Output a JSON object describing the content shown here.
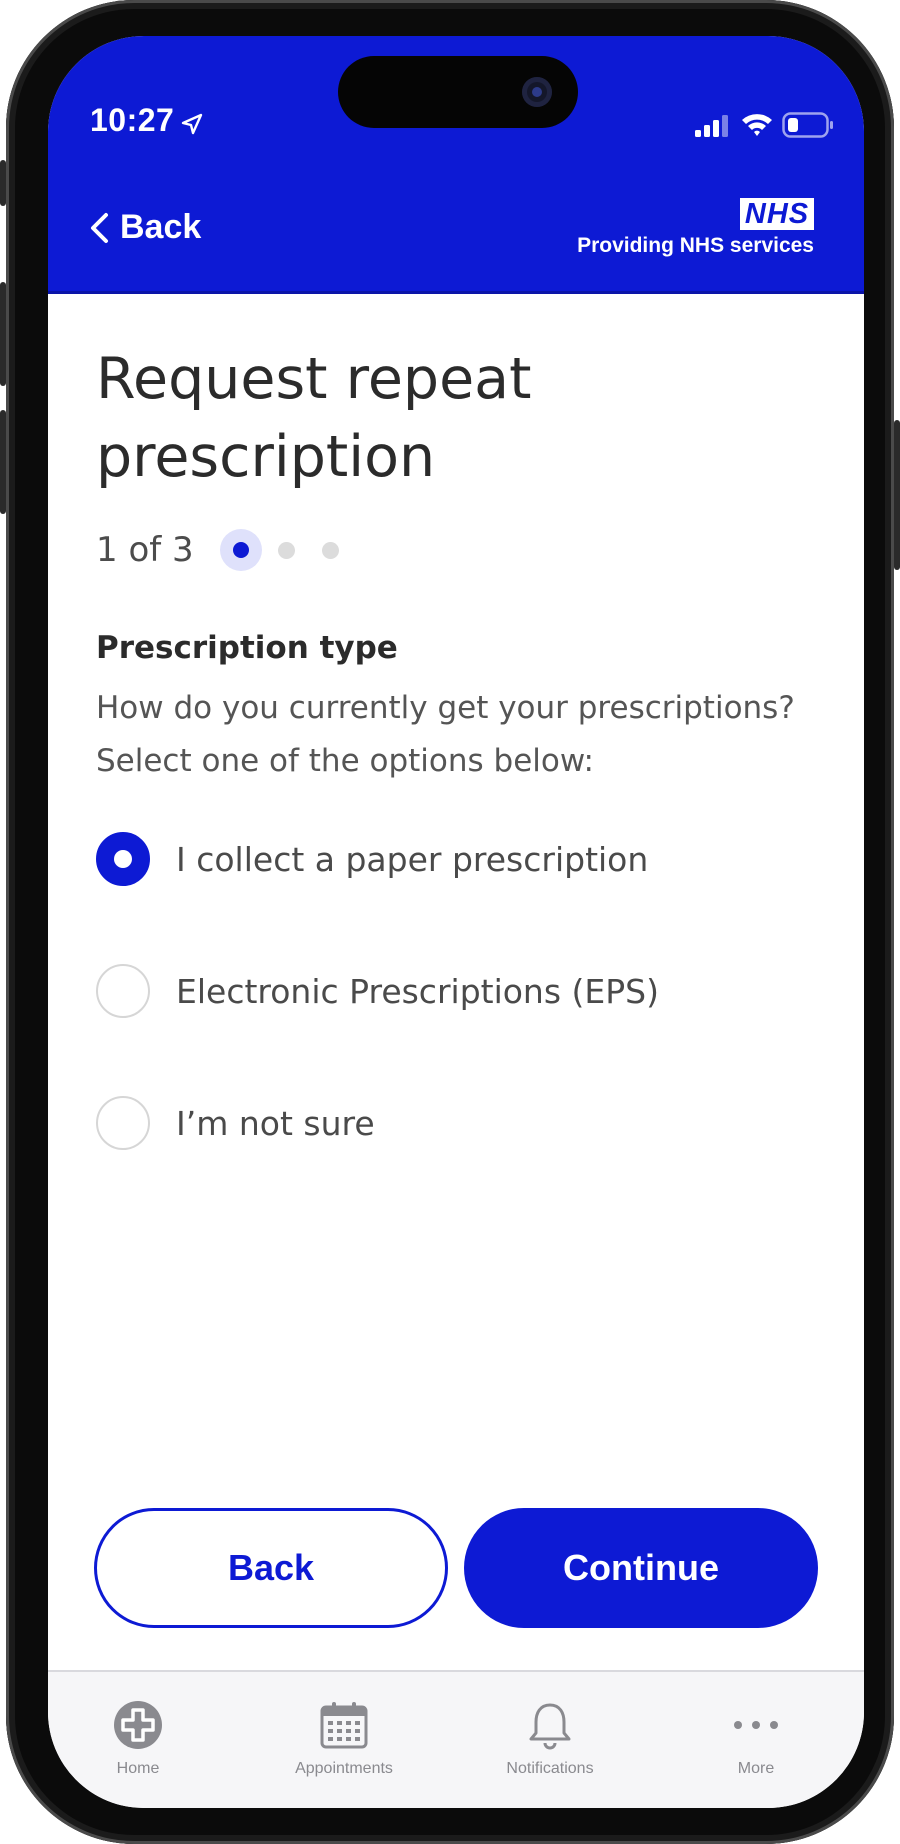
{
  "status_bar": {
    "time": "10:27"
  },
  "header": {
    "back_label": "Back",
    "logo_text": "NHS",
    "logo_subtitle": "Providing NHS services"
  },
  "page": {
    "title": "Request repeat prescription",
    "step_text": "1 of 3",
    "step_current": 1,
    "step_total": 3,
    "section_label": "Prescription type",
    "section_help": "How do you currently get your prescriptions? Select one of the options below:"
  },
  "options": [
    {
      "label": "I collect a paper prescription",
      "selected": true
    },
    {
      "label": "Electronic Prescriptions (EPS)",
      "selected": false
    },
    {
      "label": "I’m not sure",
      "selected": false
    }
  ],
  "buttons": {
    "back_label": "Back",
    "continue_label": "Continue"
  },
  "tabbar": {
    "items": [
      {
        "label": "Home",
        "icon": "home-cross-icon"
      },
      {
        "label": "Appointments",
        "icon": "calendar-icon"
      },
      {
        "label": "Notifications",
        "icon": "bell-icon"
      },
      {
        "label": "More",
        "icon": "more-dots-icon"
      }
    ]
  },
  "colors": {
    "brand_blue": "#0d1ad4",
    "text_dark": "#2b2b2b",
    "text_muted": "#555555",
    "tab_grey": "#8a8a8f"
  }
}
